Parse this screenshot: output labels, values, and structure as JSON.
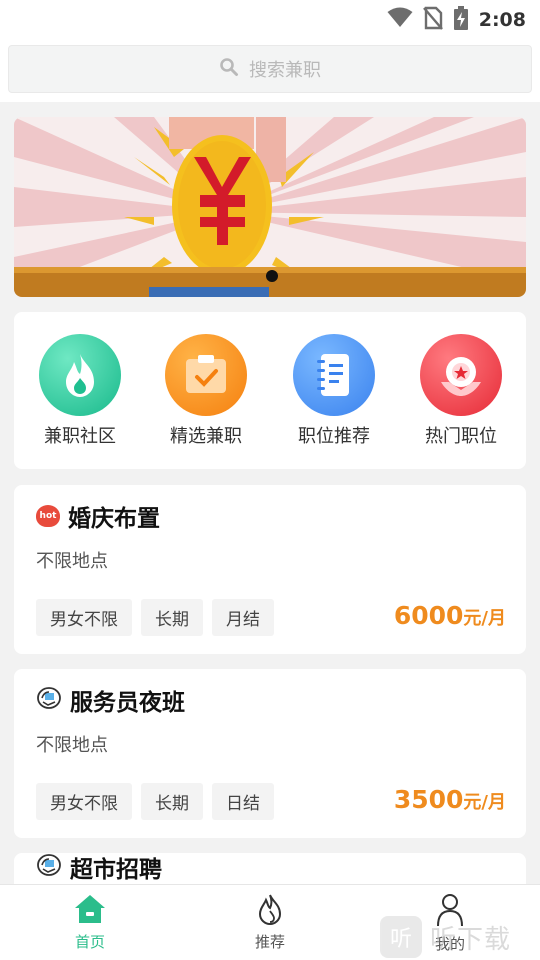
{
  "status_bar": {
    "time": "2:08"
  },
  "search": {
    "placeholder": "搜索兼职"
  },
  "banner": {
    "symbol": "¥"
  },
  "categories": [
    {
      "label": "兼职社区",
      "icon": "flame-icon",
      "color": "#22c59a"
    },
    {
      "label": "精选兼职",
      "icon": "clipboard-check-icon",
      "color": "#f88a18"
    },
    {
      "label": "职位推荐",
      "icon": "notebook-icon",
      "color": "#3f8ef2"
    },
    {
      "label": "热门职位",
      "icon": "award-icon",
      "color": "#ee3b45"
    }
  ],
  "jobs": [
    {
      "icon": "hot-icon",
      "badge": "hot",
      "title": "婚庆布置",
      "location": "不限地点",
      "tags": [
        "男女不限",
        "长期",
        "月结"
      ],
      "salary_amount": "6000",
      "salary_unit": "元/月"
    },
    {
      "icon": "hand-icon",
      "title": "服务员夜班",
      "location": "不限地点",
      "tags": [
        "男女不限",
        "长期",
        "日结"
      ],
      "salary_amount": "3500",
      "salary_unit": "元/月"
    },
    {
      "icon": "hand-icon",
      "title": "超市招聘"
    }
  ],
  "nav": {
    "items": [
      {
        "label": "首页",
        "icon": "home-icon",
        "active": true
      },
      {
        "label": "推荐",
        "icon": "flame-outline-icon",
        "active": false
      },
      {
        "label": "我的",
        "icon": "user-icon",
        "active": false
      }
    ]
  },
  "watermark": {
    "logo": "听",
    "text": "听下载"
  },
  "colors": {
    "accent": "#2bbd8b",
    "salary": "#ef8b1e"
  }
}
